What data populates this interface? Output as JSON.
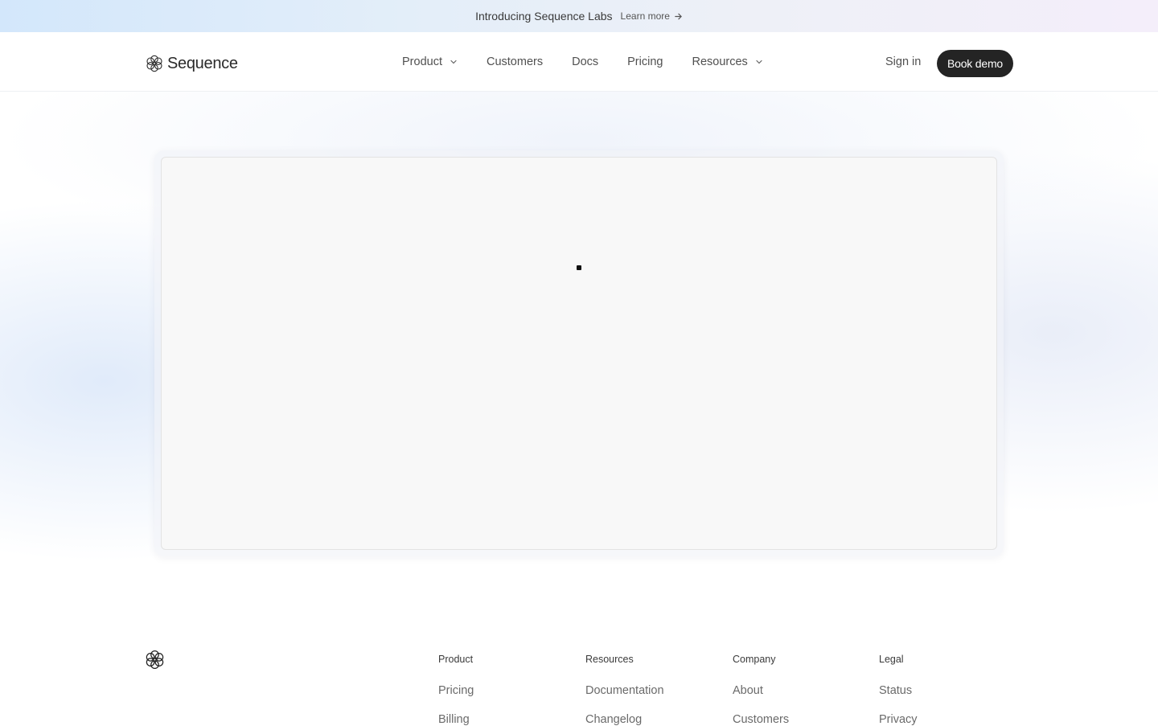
{
  "announcement": {
    "title": "Introducing Sequence Labs",
    "link_label": "Learn more",
    "link_icon": "arrow-right-icon"
  },
  "header": {
    "brand": "Sequence",
    "logo_icon": "sequence-flower-logo",
    "nav": [
      {
        "label": "Product",
        "has_dropdown": true
      },
      {
        "label": "Customers",
        "has_dropdown": false
      },
      {
        "label": "Docs",
        "has_dropdown": false
      },
      {
        "label": "Pricing",
        "has_dropdown": false
      },
      {
        "label": "Resources",
        "has_dropdown": true
      }
    ],
    "signin_label": "Sign in",
    "cta_label": "Book demo"
  },
  "colors": {
    "cta_background": "#242424",
    "announcement_gradient_start": "#d3e7fb",
    "announcement_gradient_end": "#f4eefa",
    "frame_background": "#f8f8f8"
  },
  "footer": {
    "columns": [
      {
        "heading": "Product",
        "links": [
          "Pricing",
          "Billing"
        ]
      },
      {
        "heading": "Resources",
        "links": [
          "Documentation",
          "Changelog"
        ]
      },
      {
        "heading": "Company",
        "links": [
          "About",
          "Customers"
        ]
      },
      {
        "heading": "Legal",
        "links": [
          "Status",
          "Privacy"
        ]
      }
    ]
  }
}
